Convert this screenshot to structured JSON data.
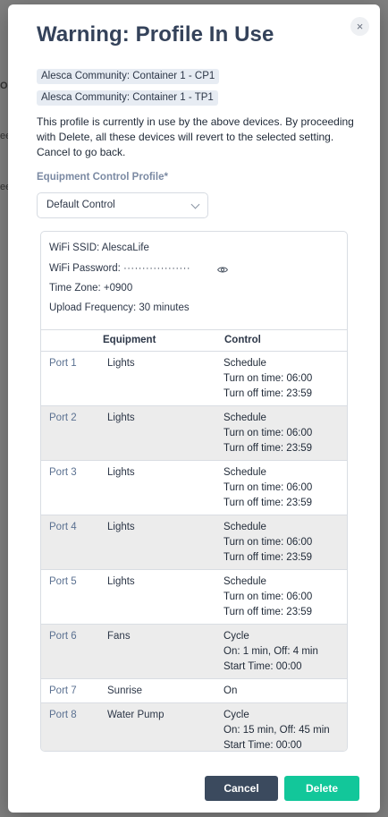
{
  "background": {
    "line1": "ON",
    "line2": "ee",
    "line3": "ee"
  },
  "modal": {
    "close_glyph": "×",
    "title": "Warning: Profile In Use",
    "devices": [
      "Alesca Community: Container 1 - CP1",
      "Alesca Community: Container 1 - TP1"
    ],
    "description": "This profile is currently in use by the above devices. By proceeding with Delete, all these devices will revert to the selected setting. Cancel to go back.",
    "profile_label": "Equipment Control Profile*",
    "profile_value": "Default Control",
    "info": {
      "wifi_ssid": "WiFi SSID: AlescaLife",
      "wifi_password_label": "WiFi Password:",
      "wifi_password_mask": "··················",
      "time_zone": "Time Zone: +0900",
      "upload_frequency": "Upload Frequency: 30 minutes"
    },
    "table": {
      "headers": {
        "equipment": "Equipment",
        "control": "Control"
      },
      "rows": [
        {
          "port": "Port 1",
          "equipment": "Lights",
          "control": [
            "Schedule",
            "Turn on time: 06:00",
            "Turn off time: 23:59"
          ]
        },
        {
          "port": "Port 2",
          "equipment": "Lights",
          "control": [
            "Schedule",
            "Turn on time: 06:00",
            "Turn off time: 23:59"
          ]
        },
        {
          "port": "Port 3",
          "equipment": "Lights",
          "control": [
            "Schedule",
            "Turn on time: 06:00",
            "Turn off time: 23:59"
          ]
        },
        {
          "port": "Port 4",
          "equipment": "Lights",
          "control": [
            "Schedule",
            "Turn on time: 06:00",
            "Turn off time: 23:59"
          ]
        },
        {
          "port": "Port 5",
          "equipment": "Lights",
          "control": [
            "Schedule",
            "Turn on time: 06:00",
            "Turn off time: 23:59"
          ]
        },
        {
          "port": "Port 6",
          "equipment": "Fans",
          "control": [
            "Cycle",
            "On: 1 min, Off: 4 min",
            "Start Time: 00:00"
          ]
        },
        {
          "port": "Port 7",
          "equipment": "Sunrise",
          "control": [
            "On"
          ]
        },
        {
          "port": "Port 8",
          "equipment": "Water Pump",
          "control": [
            "Cycle",
            "On: 15 min, Off: 45 min",
            "Start Time: 00:00"
          ]
        }
      ]
    },
    "buttons": {
      "cancel": "Cancel",
      "delete": "Delete"
    }
  },
  "colors": {
    "primary_dark": "#3b4a5e",
    "accent_green": "#12c79a",
    "link": "#5b7191"
  }
}
